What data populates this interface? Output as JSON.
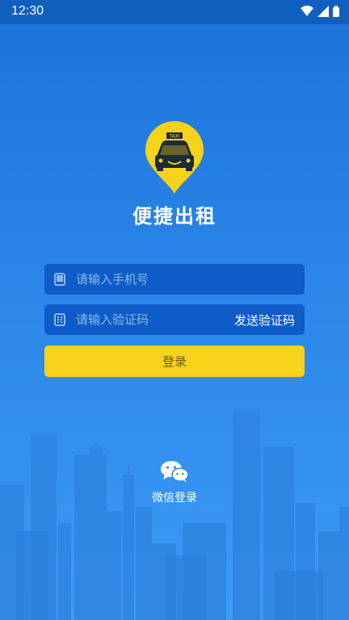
{
  "status_bar": {
    "time": "12:30",
    "icons": [
      "wifi-icon",
      "signal-icon",
      "battery-icon"
    ]
  },
  "app": {
    "title": "便捷出租",
    "logo_icon": "taxi-icon",
    "logo_badge": "TAXI"
  },
  "form": {
    "phone_placeholder": "请输入手机号",
    "phone_icon": "phone-icon",
    "code_placeholder": "请输入验证码",
    "code_icon": "keypad-icon",
    "send_code_label": "发送验证码",
    "login_label": "登录"
  },
  "social": {
    "wechat_label": "微信登录",
    "wechat_icon": "wechat-icon"
  },
  "colors": {
    "background_top": "#1a73d9",
    "background_bottom": "#3d9af5",
    "field_bg": "#0d5cc8",
    "accent_yellow": "#f7d21a"
  }
}
